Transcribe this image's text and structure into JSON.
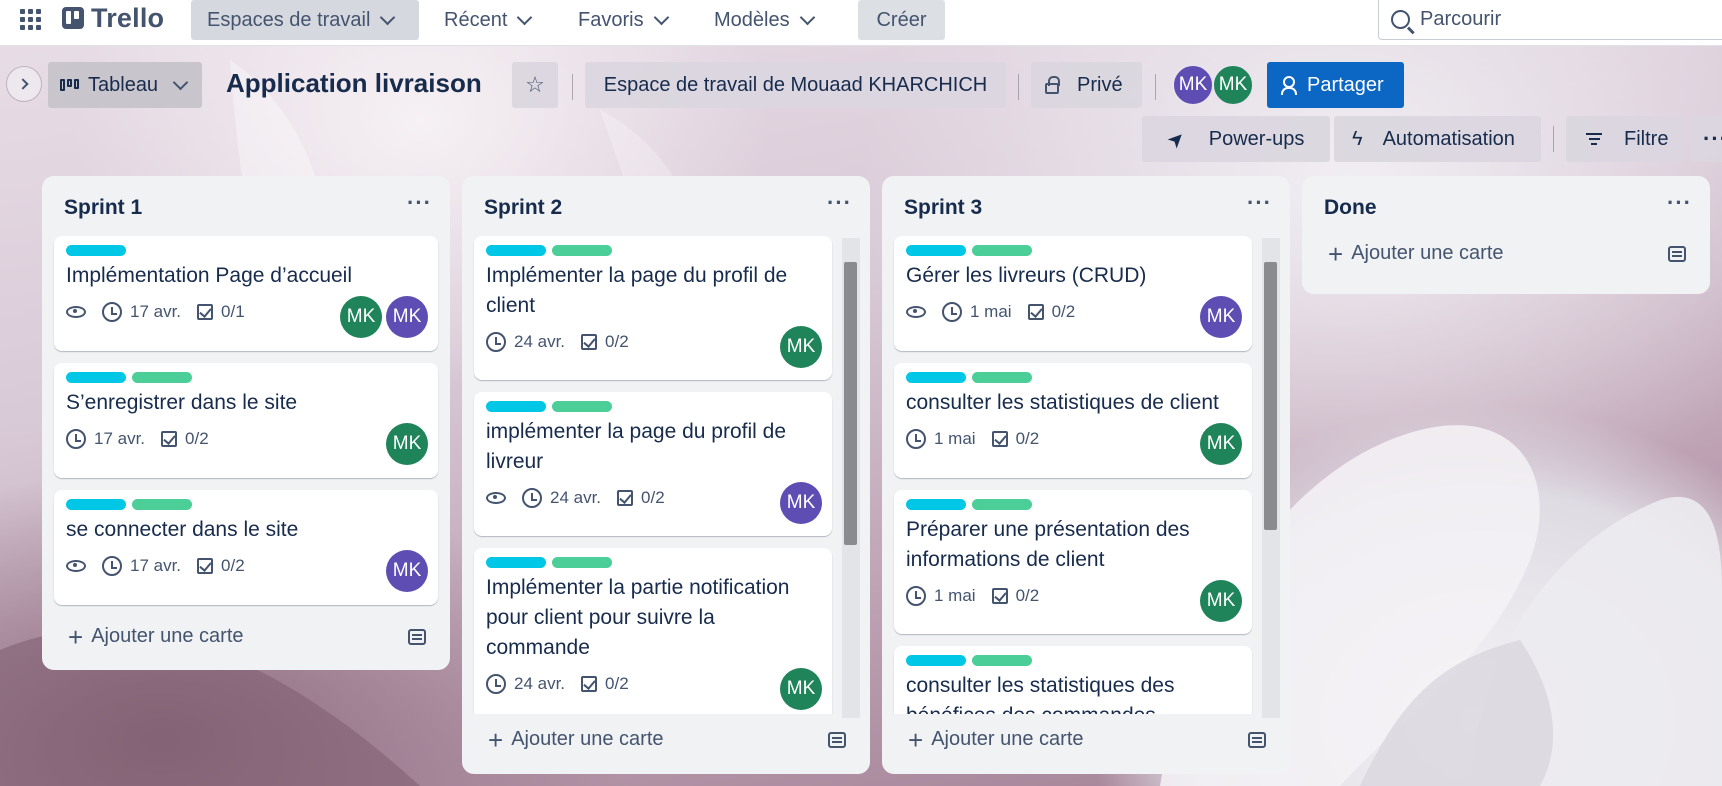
{
  "app": {
    "logo": "Trello"
  },
  "topnav": {
    "items": [
      {
        "label": "Espaces de travail",
        "active": true
      },
      {
        "label": "Récent"
      },
      {
        "label": "Favoris"
      },
      {
        "label": "Modèles"
      }
    ],
    "create_label": "Créer",
    "search_placeholder": "Parcourir"
  },
  "board": {
    "view_label": "Tableau",
    "title": "Application livraison",
    "workspace_label": "Espace de travail de Mouaad KHARCHICH",
    "visibility_label": "Privé",
    "members": [
      {
        "initials": "MK",
        "color": "#5e4db2"
      },
      {
        "initials": "MK",
        "color": "#1f845a"
      }
    ],
    "share_label": "Partager",
    "powerups_label": "Power-ups",
    "automation_label": "Automatisation",
    "filter_label": "Filtre"
  },
  "colors": {
    "cyan_label": "#00c7e6",
    "green_label": "#4bce97",
    "accent_blue": "#0c66c4",
    "avatar_purple": "#5e4db2",
    "avatar_green": "#1f845a"
  },
  "lists": [
    {
      "title": "Sprint 1",
      "add_label": "Ajouter une carte",
      "cards": [
        {
          "title": "Implémentation Page d’accueil",
          "labels": [
            "cyan"
          ],
          "watching": true,
          "due": "17 avr.",
          "checklist": "0/1",
          "members": [
            "MK",
            "MK"
          ],
          "member_colors": [
            "#1f845a",
            "#5e4db2"
          ]
        },
        {
          "title": "S’enregistrer dans le site",
          "labels": [
            "cyan",
            "green"
          ],
          "watching": false,
          "due": "17 avr.",
          "checklist": "0/2",
          "members": [
            "MK"
          ],
          "member_colors": [
            "#1f845a"
          ]
        },
        {
          "title": "se connecter dans le site",
          "labels": [
            "cyan",
            "green"
          ],
          "watching": true,
          "due": "17 avr.",
          "checklist": "0/2",
          "members": [
            "MK"
          ],
          "member_colors": [
            "#5e4db2"
          ]
        }
      ]
    },
    {
      "title": "Sprint 2",
      "add_label": "Ajouter une carte",
      "cards": [
        {
          "title": "Implémenter la page du profil de client",
          "labels": [
            "cyan",
            "green"
          ],
          "watching": false,
          "due": "24 avr.",
          "checklist": "0/2",
          "members": [
            "MK"
          ],
          "member_colors": [
            "#1f845a"
          ]
        },
        {
          "title": "implémenter la page du profil de livreur",
          "labels": [
            "cyan",
            "green"
          ],
          "watching": true,
          "due": "24 avr.",
          "checklist": "0/2",
          "members": [
            "MK"
          ],
          "member_colors": [
            "#5e4db2"
          ]
        },
        {
          "title": "Implémenter la partie notification pour client pour suivre la commande",
          "labels": [
            "cyan",
            "green"
          ],
          "watching": false,
          "due": "24 avr.",
          "checklist": "0/2",
          "members": [
            "MK"
          ],
          "member_colors": [
            "#1f845a"
          ]
        }
      ]
    },
    {
      "title": "Sprint 3",
      "add_label": "Ajouter une carte",
      "cards": [
        {
          "title": "Gérer les livreurs (CRUD)",
          "labels": [
            "cyan",
            "green"
          ],
          "watching": true,
          "due": "1 mai",
          "checklist": "0/2",
          "members": [
            "MK"
          ],
          "member_colors": [
            "#5e4db2"
          ]
        },
        {
          "title": "consulter les statistiques de client",
          "labels": [
            "cyan",
            "green"
          ],
          "watching": false,
          "due": "1 mai",
          "checklist": "0/2",
          "members": [
            "MK"
          ],
          "member_colors": [
            "#1f845a"
          ]
        },
        {
          "title": "Préparer une présentation des informations de client",
          "labels": [
            "cyan",
            "green"
          ],
          "watching": false,
          "due": "1 mai",
          "checklist": "0/2",
          "members": [
            "MK"
          ],
          "member_colors": [
            "#1f845a"
          ]
        },
        {
          "title": "consulter les statistiques des bénéfices des commandes",
          "labels": [
            "cyan",
            "green"
          ],
          "watching": false,
          "due": "",
          "checklist": "",
          "members": [],
          "member_colors": []
        }
      ]
    },
    {
      "title": "Done",
      "add_label": "Ajouter une carte",
      "cards": []
    }
  ]
}
